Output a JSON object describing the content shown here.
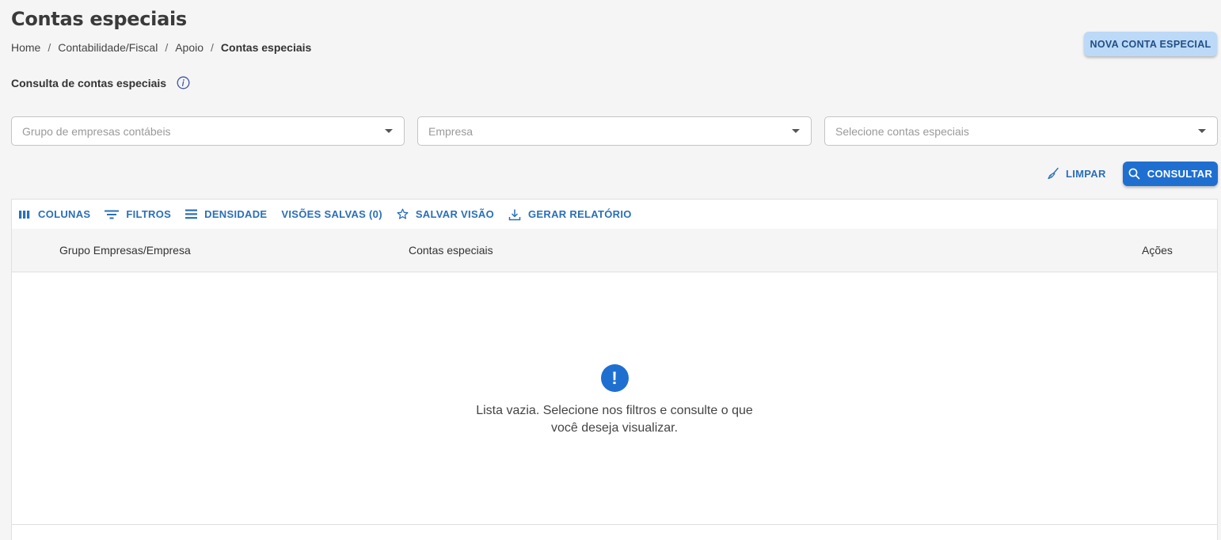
{
  "page": {
    "title": "Contas especiais",
    "breadcrumb": [
      {
        "label": "Home"
      },
      {
        "label": "Contabilidade/Fiscal"
      },
      {
        "label": "Apoio"
      },
      {
        "label": "Contas especiais"
      }
    ],
    "breadcrumb_separator": "/",
    "new_button_label": "NOVA CONTA ESPECIAL"
  },
  "filters": {
    "section_title": "Consulta de contas especiais",
    "group_placeholder": "Grupo de empresas contábeis",
    "company_placeholder": "Empresa",
    "accounts_placeholder": "Selecione contas especiais",
    "clear_label": "LIMPAR",
    "search_label": "CONSULTAR"
  },
  "grid": {
    "toolbar": {
      "columns": "COLUNAS",
      "filters": "FILTROS",
      "density": "DENSIDADE",
      "saved_views": "VISÕES SALVAS (0)",
      "save_view": "SALVAR VISÃO",
      "report": "GERAR RELATÓRIO"
    },
    "headers": {
      "group_company": "Grupo Empresas/Empresa",
      "accounts": "Contas especiais",
      "actions": "Ações"
    },
    "empty_icon": "!",
    "empty_message": "Lista vazia. Selecione nos filtros e consulte o que você deseja visualizar."
  },
  "colors": {
    "primary": "#1f6fd1",
    "link": "#2a6fb8",
    "secondary_button_bg": "#bcd9f7",
    "background": "#f5f5f5"
  },
  "icons": {
    "info": "info-icon",
    "caret": "caret-down-icon",
    "clear": "broom-icon",
    "search": "search-icon",
    "columns": "columns-icon",
    "filters": "filter-icon",
    "density": "density-icon",
    "save_view": "star-outline-icon",
    "report": "download-icon",
    "empty": "exclamation-icon"
  }
}
